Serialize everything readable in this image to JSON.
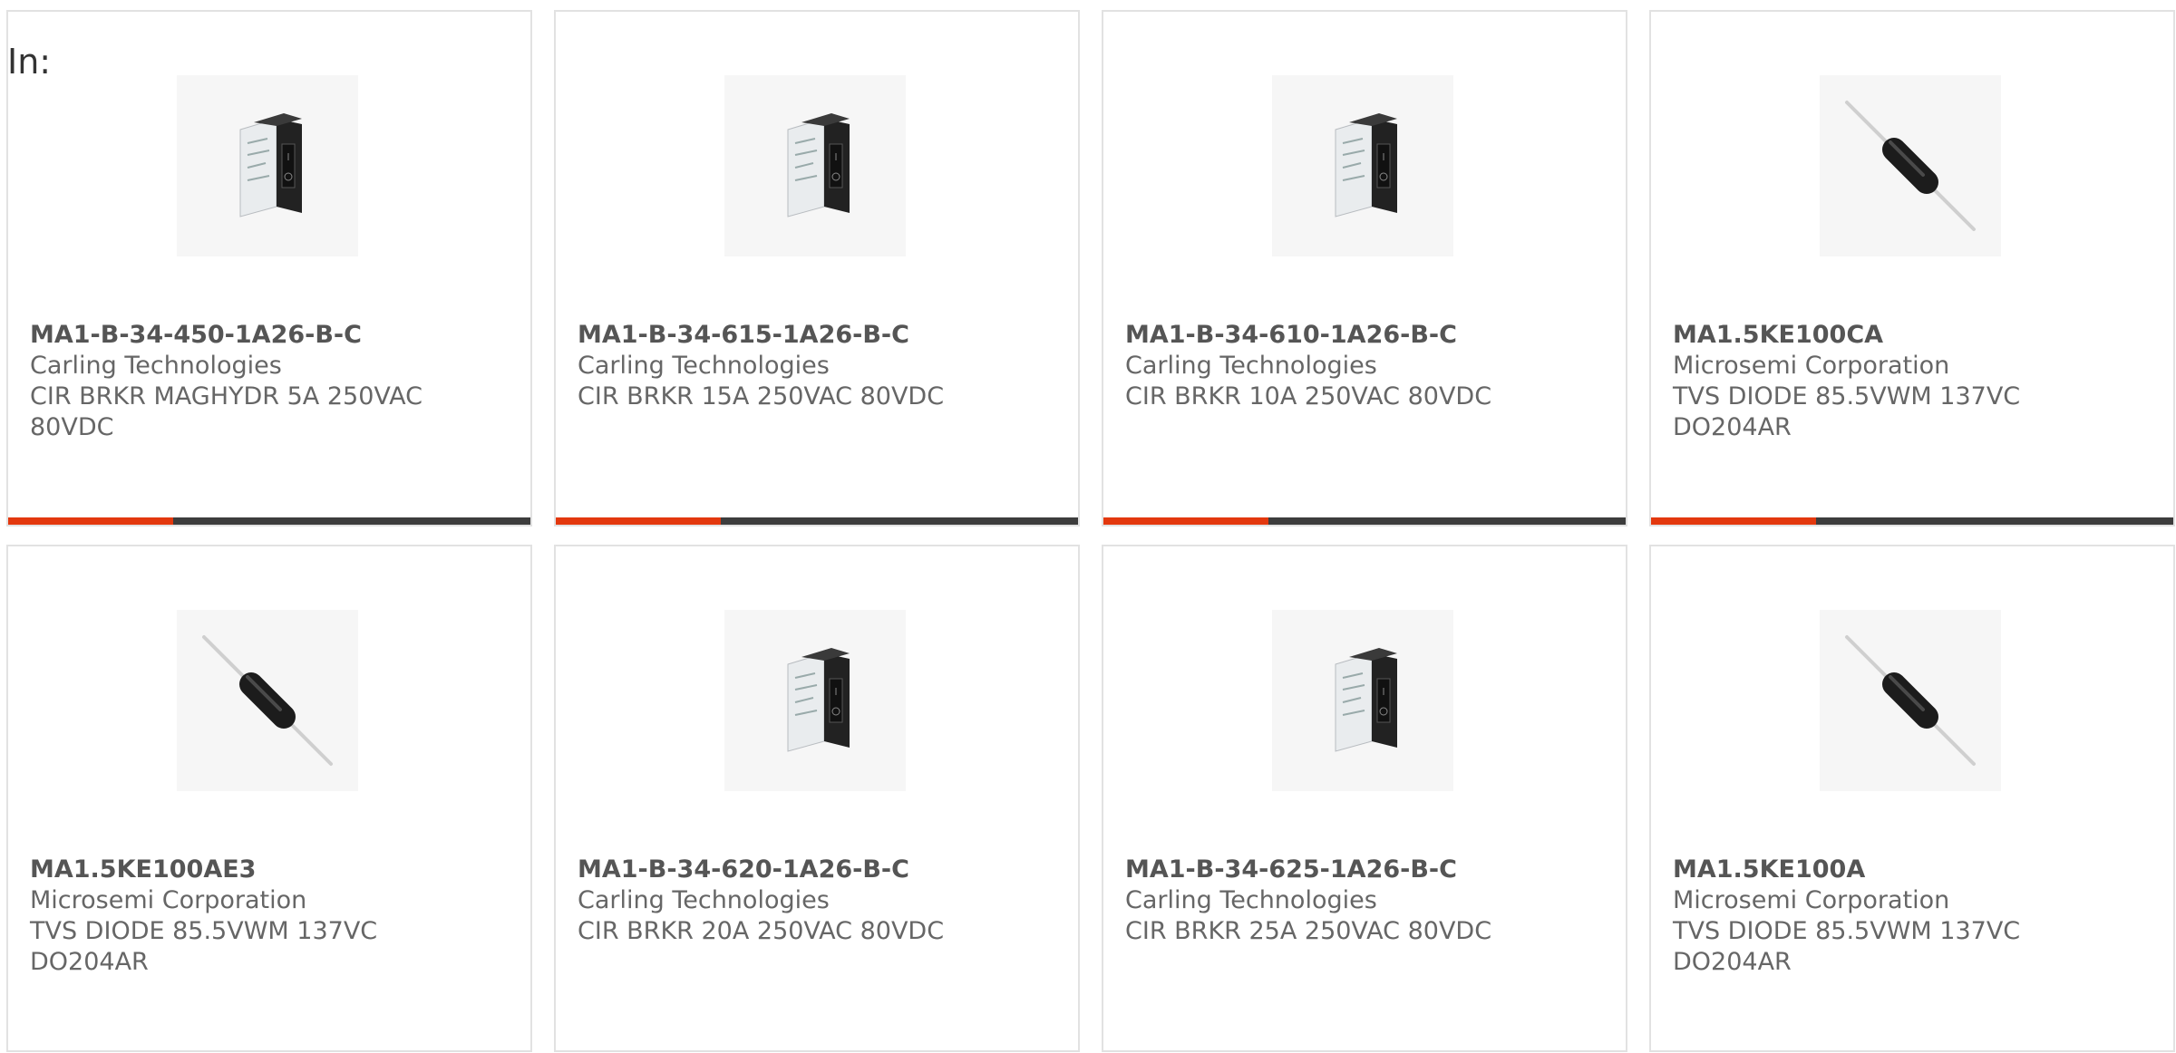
{
  "header": {
    "in_label": "In:"
  },
  "colors": {
    "accent": "#e3380e",
    "bar": "#3d3d3d",
    "border": "#e2e2e2"
  },
  "products": [
    {
      "part": "MA1-B-34-450-1A26-B-C",
      "manufacturer": "Carling Technologies",
      "description": "CIR BRKR MAGHYDR 5A 250VAC 80VDC",
      "image": "circuit-breaker-image"
    },
    {
      "part": "MA1-B-34-615-1A26-B-C",
      "manufacturer": "Carling Technologies",
      "description": "CIR BRKR 15A 250VAC 80VDC",
      "image": "circuit-breaker-image"
    },
    {
      "part": "MA1-B-34-610-1A26-B-C",
      "manufacturer": "Carling Technologies",
      "description": "CIR BRKR 10A 250VAC 80VDC",
      "image": "circuit-breaker-image"
    },
    {
      "part": "MA1.5KE100CA",
      "manufacturer": "Microsemi Corporation",
      "description": "TVS DIODE 85.5VWM 137VC DO204AR",
      "image": "diode-image"
    },
    {
      "part": "MA1.5KE100AE3",
      "manufacturer": "Microsemi Corporation",
      "description": "TVS DIODE 85.5VWM 137VC DO204AR",
      "image": "diode-image"
    },
    {
      "part": "MA1-B-34-620-1A26-B-C",
      "manufacturer": "Carling Technologies",
      "description": "CIR BRKR 20A 250VAC 80VDC",
      "image": "circuit-breaker-image"
    },
    {
      "part": "MA1-B-34-625-1A26-B-C",
      "manufacturer": "Carling Technologies",
      "description": "CIR BRKR 25A 250VAC 80VDC",
      "image": "circuit-breaker-image"
    },
    {
      "part": "MA1.5KE100A",
      "manufacturer": "Microsemi Corporation",
      "description": "TVS DIODE 85.5VWM 137VC DO204AR",
      "image": "diode-image"
    }
  ]
}
